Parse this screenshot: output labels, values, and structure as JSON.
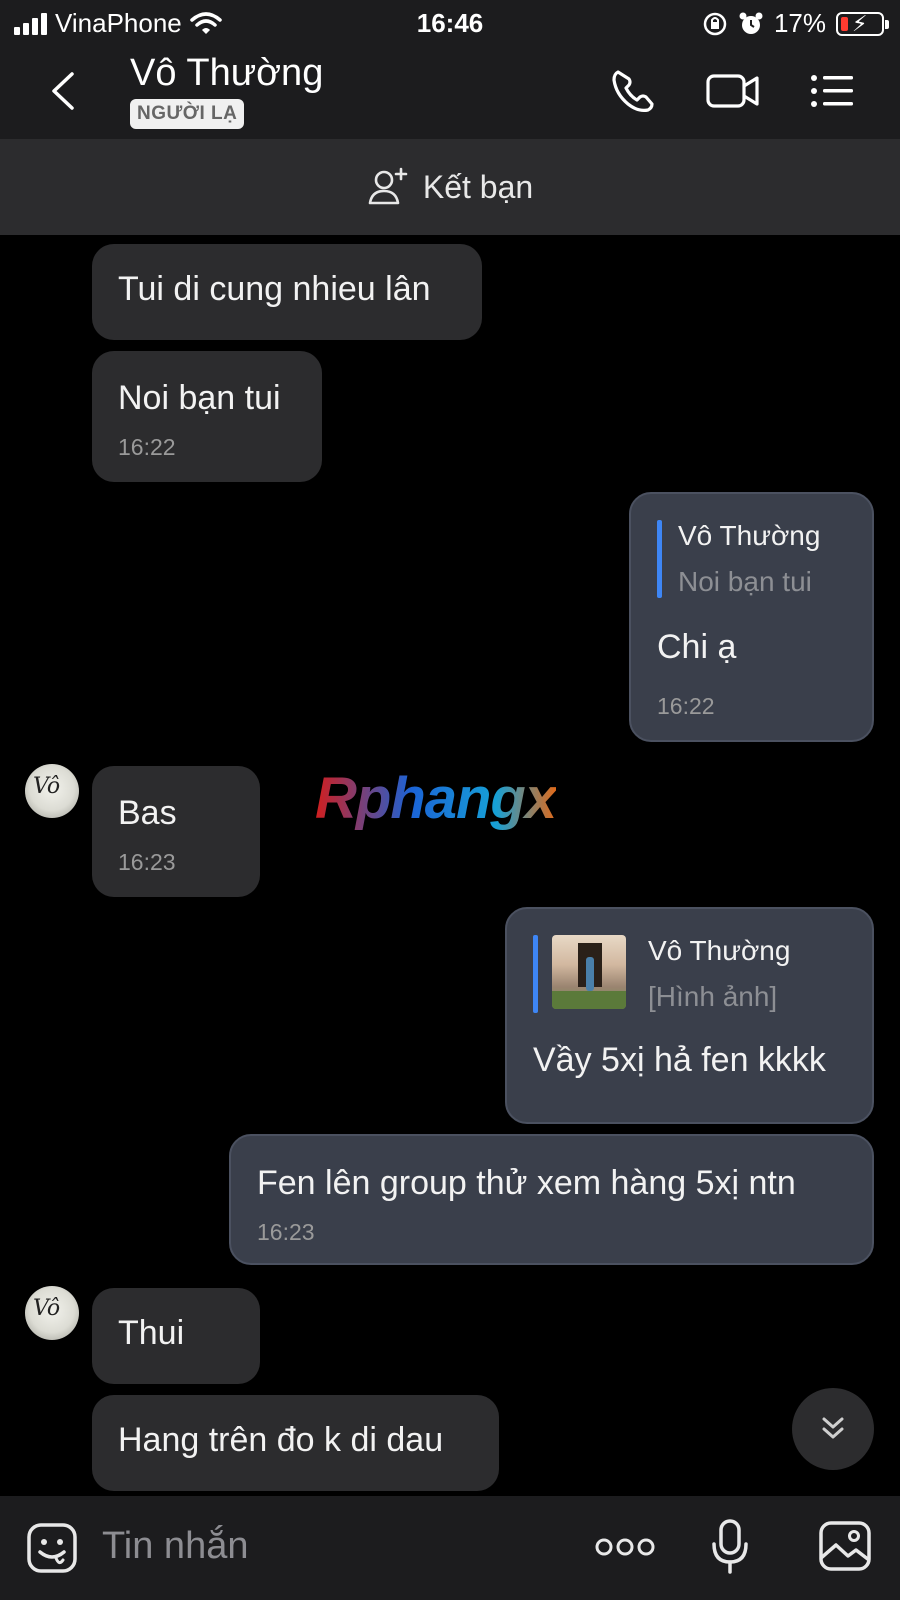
{
  "status_bar": {
    "carrier": "VinaPhone",
    "time": "16:46",
    "battery": "17%"
  },
  "header": {
    "contact_name": "Vô Thường",
    "badge": "NGƯỜI LẠ"
  },
  "add_friend": {
    "label": "Kết bạn"
  },
  "messages": [
    {
      "text": "Tui di cung nhieu lân"
    },
    {
      "text": "Noi bạn tui",
      "time": "16:22"
    },
    {
      "quote_name": "Vô Thường",
      "quote_text": "Noi bạn tui",
      "text": "Chi ạ",
      "time": "16:22"
    },
    {
      "text": "Bas",
      "time": "16:23"
    },
    {
      "quote_name": "Vô Thường",
      "quote_text": "[Hình ảnh]",
      "text": "Vầy 5xị hả fen kkkk"
    },
    {
      "text": "Fen lên group thử xem hàng 5xị ntn",
      "time": "16:23"
    },
    {
      "text": "Thui"
    },
    {
      "text": "Hang trên đo k di dau"
    }
  ],
  "watermark": "Rphangx",
  "input": {
    "placeholder": "Tin nhắn"
  }
}
